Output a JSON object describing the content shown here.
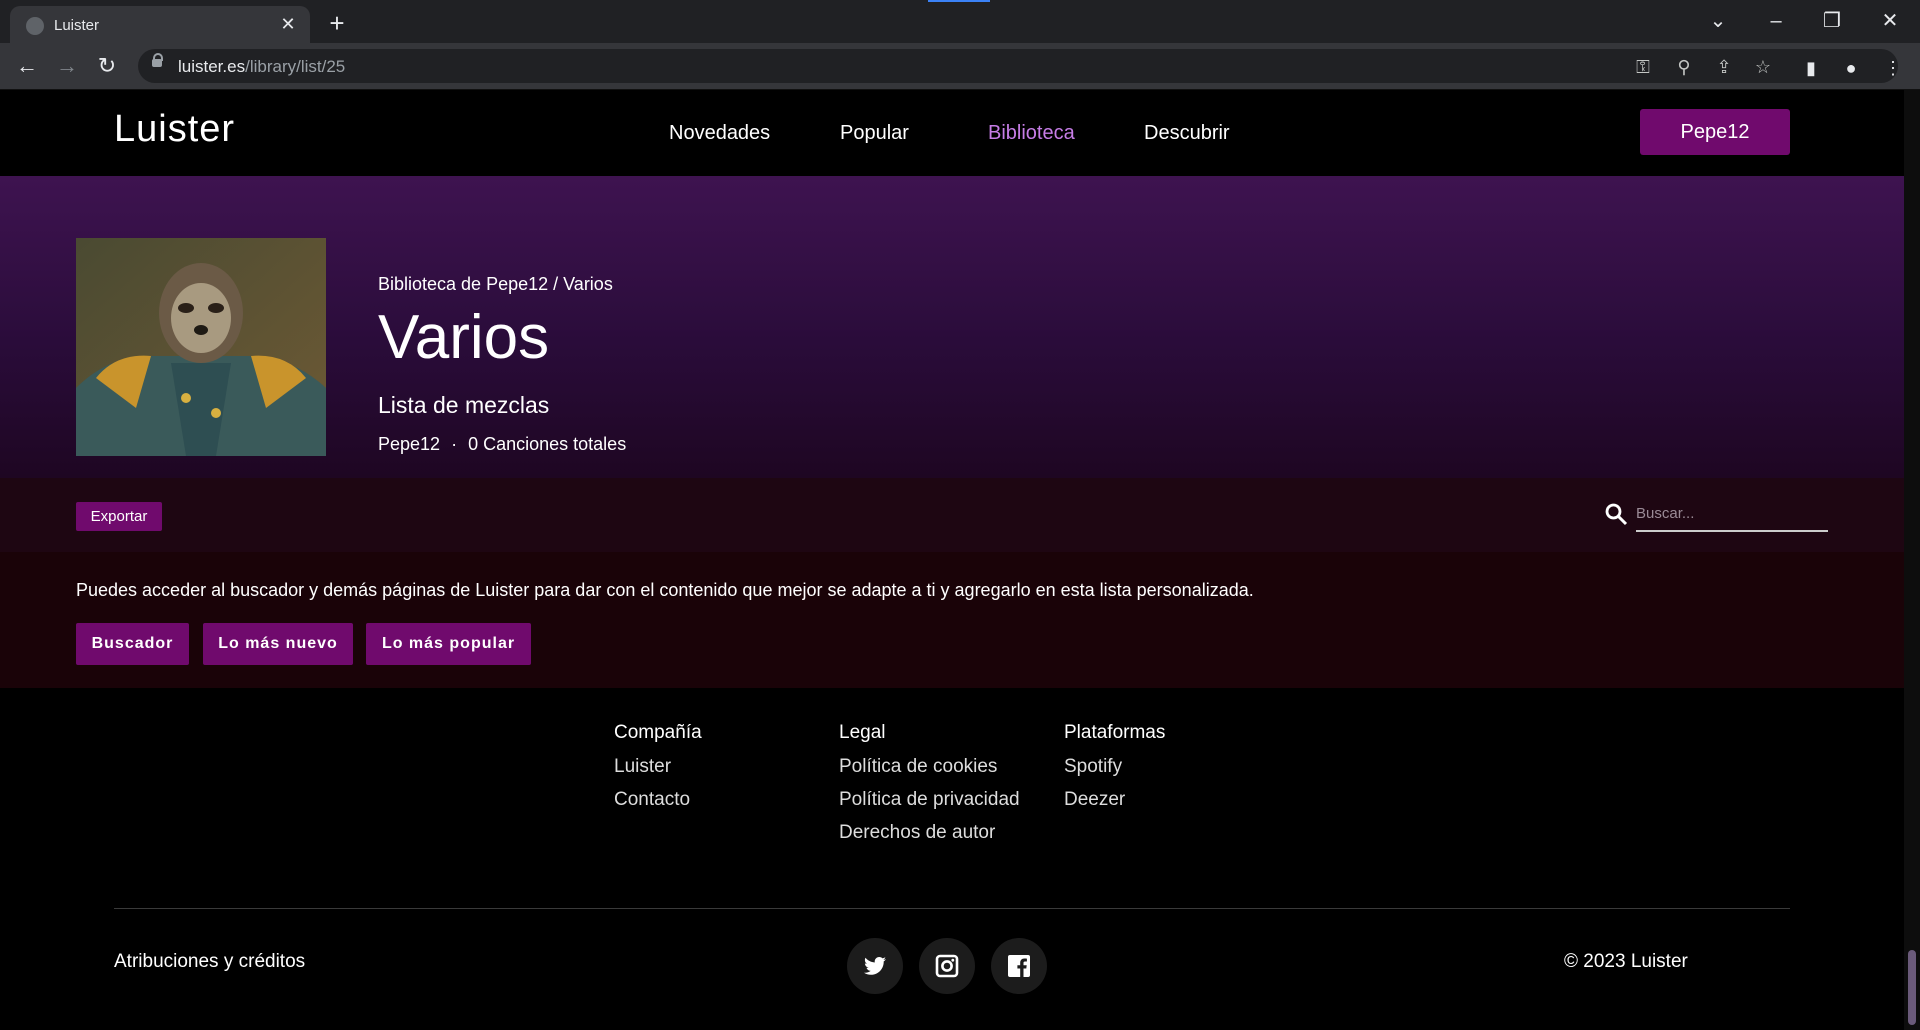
{
  "browser": {
    "tab_title": "Luister",
    "url_domain": "luister.es",
    "url_path": "/library/list/25"
  },
  "nav": {
    "logo": "Luister",
    "links": [
      "Novedades",
      "Popular",
      "Biblioteca",
      "Descubrir"
    ],
    "active": "Biblioteca",
    "user": "Pepe12"
  },
  "hero": {
    "breadcrumb": "Biblioteca de Pepe12 / Varios",
    "title": "Varios",
    "type": "Lista de mezclas",
    "owner": "Pepe12",
    "separator": "·",
    "count": "0 Canciones totales"
  },
  "toolbar": {
    "export_label": "Exportar",
    "search_placeholder": "Buscar..."
  },
  "info": {
    "text": "Puedes acceder al buscador y demás páginas de Luister para dar con el contenido que mejor se adapte a ti y agregarlo en esta lista personalizada.",
    "buttons": [
      "Buscador",
      "Lo más nuevo",
      "Lo más popular"
    ]
  },
  "footer": {
    "columns": [
      {
        "title": "Compañía",
        "links": [
          "Luister",
          "Contacto"
        ]
      },
      {
        "title": "Legal",
        "links": [
          "Política de cookies",
          "Política de privacidad",
          "Derechos de autor"
        ]
      },
      {
        "title": "Plataformas",
        "links": [
          "Spotify",
          "Deezer"
        ]
      }
    ],
    "credits": "Atribuciones y créditos",
    "social": [
      "twitter-icon",
      "instagram-icon",
      "facebook-icon"
    ],
    "copyright": "© 2023 Luister"
  },
  "colors": {
    "accent": "#700a6d",
    "active_link": "#c67de6"
  }
}
